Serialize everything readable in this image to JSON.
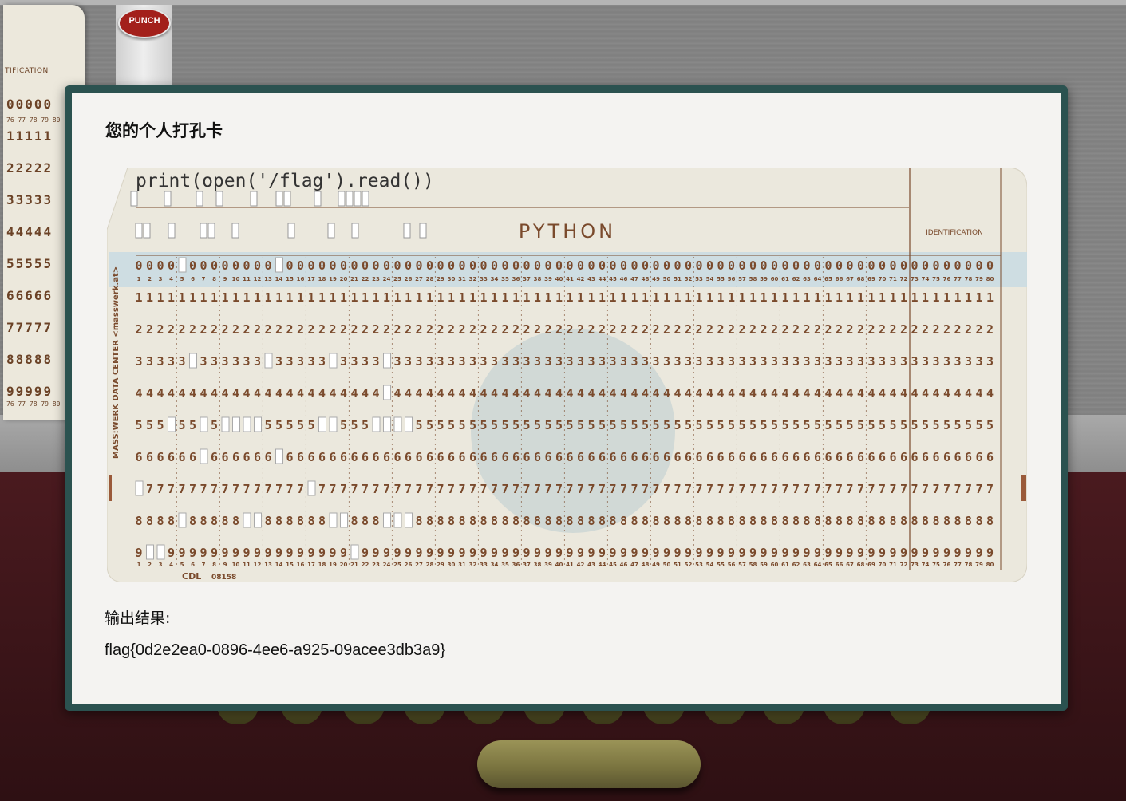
{
  "background": {
    "punch_button_label": "PUNCH",
    "left_card": {
      "ident_label": "TIFICATION",
      "rows": [
        "00000",
        "11111",
        "22222",
        "33333",
        "44444",
        "55555",
        "66666",
        "77777",
        "88888",
        "99999"
      ],
      "col_numbers": "76 77 78 79 80"
    }
  },
  "modal": {
    "title": "您的个人打孔卡",
    "output_label": "输出结果:",
    "output_value": "flag{0d2e2ea0-0896-4ee6-a925-09acee3db3a9}"
  },
  "punch_card": {
    "code_text": "print(open('/flag').read())",
    "language_label": "PYTHON",
    "identification_label": "IDENTIFICATION",
    "side_text": "MASS:WERK DATA CENTER <masswerk.at>",
    "footer_code": "CDL",
    "footer_number": "08158",
    "columns": 80,
    "card_color": "#ebe8dd",
    "ink_color": "#7a4a2c",
    "highlight_row_color": "#c9dbe3"
  }
}
